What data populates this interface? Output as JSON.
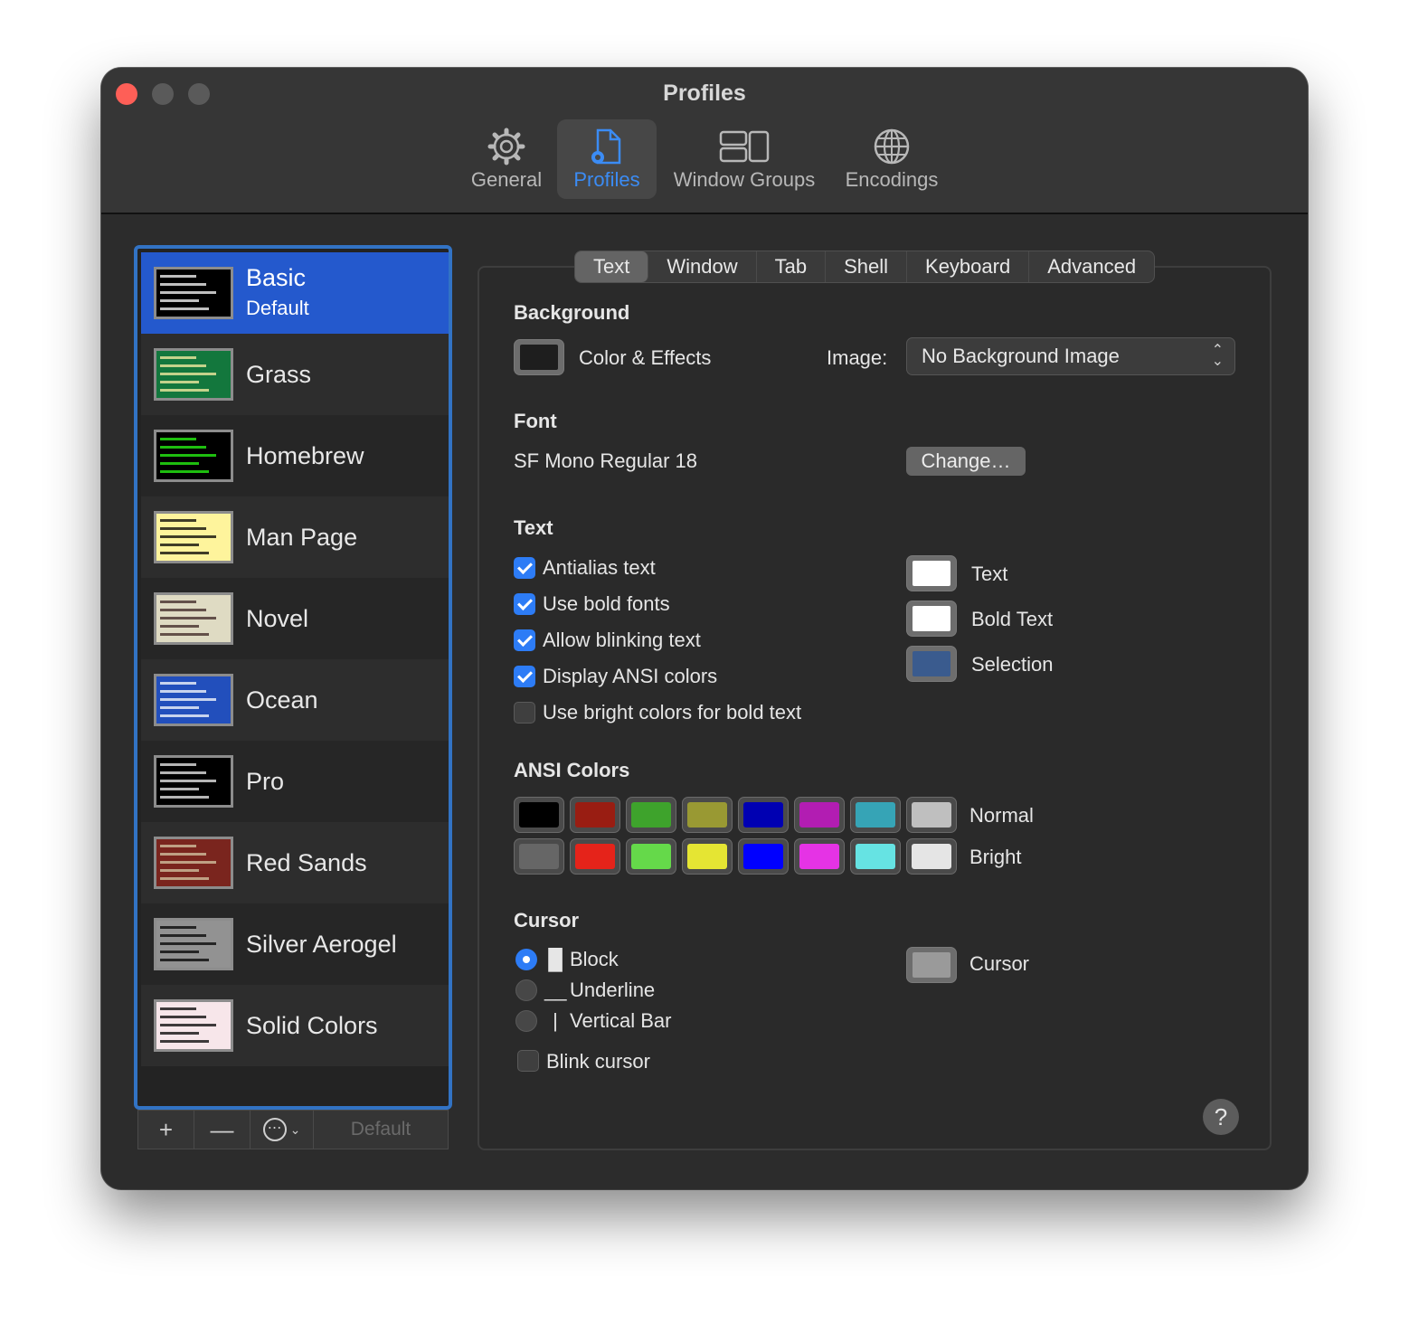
{
  "window": {
    "title": "Profiles"
  },
  "toolbar": {
    "items": [
      {
        "label": "General",
        "icon": "gear-icon"
      },
      {
        "label": "Profiles",
        "icon": "profiles-icon",
        "active": true
      },
      {
        "label": "Window Groups",
        "icon": "window-groups-icon"
      },
      {
        "label": "Encodings",
        "icon": "globe-icon"
      }
    ]
  },
  "profiles": [
    {
      "name": "Basic",
      "sub": "Default",
      "bg": "#000000",
      "fg": "#ffffff",
      "selected": true
    },
    {
      "name": "Grass",
      "bg": "#13773d",
      "fg": "#fff0a5"
    },
    {
      "name": "Homebrew",
      "bg": "#000000",
      "fg": "#28fe14"
    },
    {
      "name": "Man Page",
      "bg": "#fef49c",
      "fg": "#000000"
    },
    {
      "name": "Novel",
      "bg": "#dfdbc3",
      "fg": "#3b2322"
    },
    {
      "name": "Ocean",
      "bg": "#224fbc",
      "fg": "#ffffff"
    },
    {
      "name": "Pro",
      "bg": "#000000",
      "fg": "#f2f2f2"
    },
    {
      "name": "Red Sands",
      "bg": "#7a251e",
      "fg": "#d7c9a7"
    },
    {
      "name": "Silver Aerogel",
      "bg": "#929292",
      "fg": "#000000"
    },
    {
      "name": "Solid Colors",
      "bg": "#f7e6ea",
      "fg": "#000000"
    }
  ],
  "sidebar_bottom": {
    "add": "+",
    "remove": "—",
    "more": "⋯",
    "default": "Default"
  },
  "tabs": [
    "Text",
    "Window",
    "Tab",
    "Shell",
    "Keyboard",
    "Advanced"
  ],
  "background": {
    "section": "Background",
    "color_effects": "Color & Effects",
    "image_label": "Image:",
    "image_value": "No Background Image",
    "swatch_color": "#1e1e1e"
  },
  "font": {
    "section": "Font",
    "value": "SF Mono Regular 18",
    "change": "Change…"
  },
  "text": {
    "section": "Text",
    "checkboxes": [
      {
        "label": "Antialias text",
        "checked": true
      },
      {
        "label": "Use bold fonts",
        "checked": true
      },
      {
        "label": "Allow blinking text",
        "checked": true
      },
      {
        "label": "Display ANSI colors",
        "checked": true
      },
      {
        "label": "Use bright colors for bold text",
        "checked": false
      }
    ],
    "colors": [
      {
        "label": "Text",
        "color": "#ffffff"
      },
      {
        "label": "Bold Text",
        "color": "#ffffff"
      },
      {
        "label": "Selection",
        "color": "#3a5b8e"
      }
    ]
  },
  "ansi": {
    "section": "ANSI Colors",
    "normal_label": "Normal",
    "bright_label": "Bright",
    "normal": [
      "#000000",
      "#991d12",
      "#3ea32c",
      "#999933",
      "#0000b2",
      "#b21db2",
      "#36a4b6",
      "#bfbfbf"
    ],
    "bright": [
      "#666666",
      "#e5231a",
      "#65d94a",
      "#e5e533",
      "#0000ff",
      "#e533e5",
      "#66e3e3",
      "#e5e5e5"
    ]
  },
  "cursor": {
    "section": "Cursor",
    "options": [
      {
        "label": "Block",
        "glyph": "█",
        "selected": true
      },
      {
        "label": "Underline",
        "glyph": "__",
        "selected": false
      },
      {
        "label": "Vertical Bar",
        "glyph": "|",
        "selected": false
      }
    ],
    "blink": "Blink cursor",
    "color_label": "Cursor",
    "color": "#9a9a9a"
  },
  "help": "?"
}
